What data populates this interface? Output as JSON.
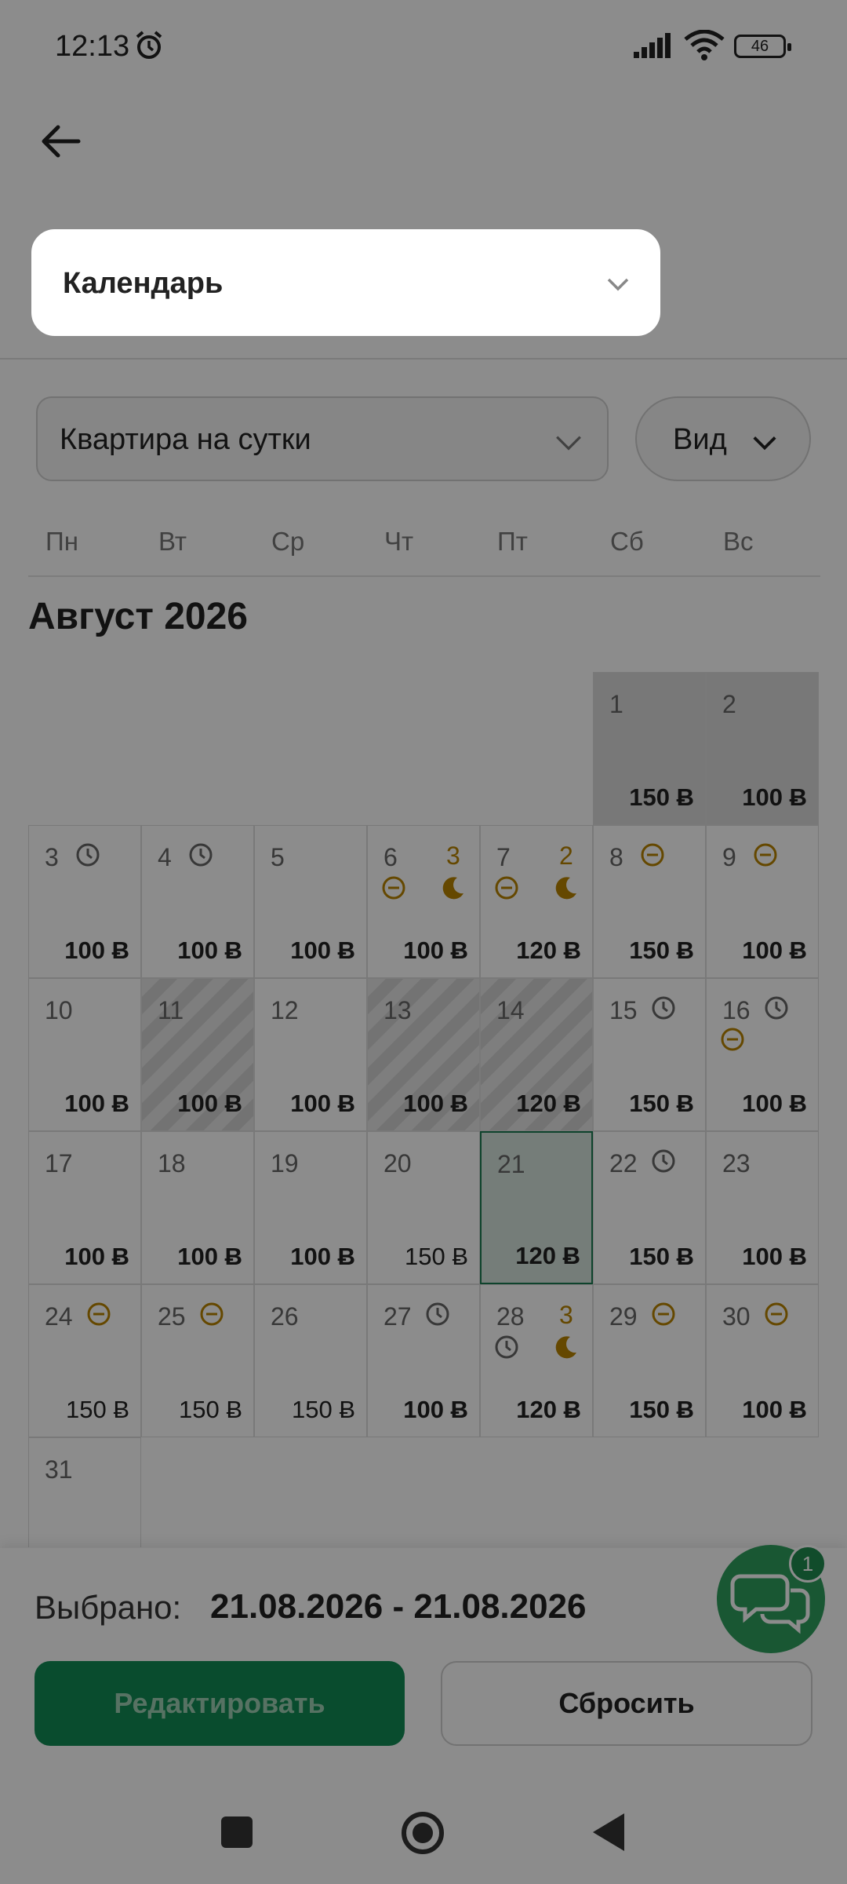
{
  "status": {
    "time": "12:13",
    "battery": "46"
  },
  "page_select": {
    "label": "Календарь"
  },
  "property_select": {
    "label": "Квартира на сутки"
  },
  "view_button": {
    "label": "Вид"
  },
  "weekdays": [
    "Пн",
    "Вт",
    "Ср",
    "Чт",
    "Пт",
    "Сб",
    "Вс"
  ],
  "month_title": "Август 2026",
  "days": [
    {
      "day": "1",
      "price": "150 Ƀ",
      "bold": true,
      "style": "weekend",
      "icons": []
    },
    {
      "day": "2",
      "price": "100 Ƀ",
      "bold": true,
      "style": "weekend",
      "icons": []
    },
    {
      "day": "3",
      "price": "100 Ƀ",
      "bold": true,
      "style": "",
      "icons": [
        "clock"
      ]
    },
    {
      "day": "4",
      "price": "100 Ƀ",
      "bold": true,
      "style": "",
      "icons": [
        "clock"
      ]
    },
    {
      "day": "5",
      "price": "100 Ƀ",
      "bold": true,
      "style": "",
      "icons": []
    },
    {
      "day": "6",
      "price": "100 Ƀ",
      "bold": true,
      "style": "",
      "icons": [
        "minus-row2"
      ],
      "count": "3"
    },
    {
      "day": "7",
      "price": "120 Ƀ",
      "bold": true,
      "style": "",
      "icons": [
        "minus-row2"
      ],
      "count": "2"
    },
    {
      "day": "8",
      "price": "150 Ƀ",
      "bold": true,
      "style": "",
      "icons": [
        "minus"
      ]
    },
    {
      "day": "9",
      "price": "100 Ƀ",
      "bold": true,
      "style": "",
      "icons": [
        "minus"
      ]
    },
    {
      "day": "10",
      "price": "100 Ƀ",
      "bold": true,
      "style": "",
      "icons": []
    },
    {
      "day": "11",
      "price": "100 Ƀ",
      "bold": true,
      "style": "striped",
      "icons": []
    },
    {
      "day": "12",
      "price": "100 Ƀ",
      "bold": true,
      "style": "",
      "icons": []
    },
    {
      "day": "13",
      "price": "100 Ƀ",
      "bold": true,
      "style": "striped",
      "icons": []
    },
    {
      "day": "14",
      "price": "120 Ƀ",
      "bold": true,
      "style": "striped",
      "icons": []
    },
    {
      "day": "15",
      "price": "150 Ƀ",
      "bold": true,
      "style": "",
      "icons": [
        "clock"
      ]
    },
    {
      "day": "16",
      "price": "100 Ƀ",
      "bold": true,
      "style": "",
      "icons": [
        "clock",
        "minus-row2-left"
      ]
    },
    {
      "day": "17",
      "price": "100 Ƀ",
      "bold": true,
      "style": "",
      "icons": []
    },
    {
      "day": "18",
      "price": "100 Ƀ",
      "bold": true,
      "style": "",
      "icons": []
    },
    {
      "day": "19",
      "price": "100 Ƀ",
      "bold": true,
      "style": "",
      "icons": []
    },
    {
      "day": "20",
      "price": "150 Ƀ",
      "bold": false,
      "style": "",
      "icons": []
    },
    {
      "day": "21",
      "price": "120 Ƀ",
      "bold": true,
      "style": "selected",
      "icons": []
    },
    {
      "day": "22",
      "price": "150 Ƀ",
      "bold": true,
      "style": "",
      "icons": [
        "clock"
      ]
    },
    {
      "day": "23",
      "price": "100 Ƀ",
      "bold": true,
      "style": "",
      "icons": []
    },
    {
      "day": "24",
      "price": "150 Ƀ",
      "bold": false,
      "style": "",
      "icons": [
        "minus"
      ]
    },
    {
      "day": "25",
      "price": "150 Ƀ",
      "bold": false,
      "style": "",
      "icons": [
        "minus"
      ]
    },
    {
      "day": "26",
      "price": "150 Ƀ",
      "bold": false,
      "style": "",
      "icons": []
    },
    {
      "day": "27",
      "price": "100 Ƀ",
      "bold": true,
      "style": "",
      "icons": [
        "clock"
      ]
    },
    {
      "day": "28",
      "price": "120 Ƀ",
      "bold": true,
      "style": "",
      "icons": [
        "clock-row2"
      ],
      "count": "3"
    },
    {
      "day": "29",
      "price": "150 Ƀ",
      "bold": true,
      "style": "",
      "icons": [
        "minus"
      ]
    },
    {
      "day": "30",
      "price": "100 Ƀ",
      "bold": true,
      "style": "",
      "icons": [
        "minus"
      ]
    },
    {
      "day": "31",
      "price": "",
      "bold": false,
      "style": "",
      "icons": []
    }
  ],
  "bottom": {
    "selected_label": "Выбрано:",
    "selected_value": "21.08.2026 - 21.08.2026",
    "edit_label": "Редактировать",
    "reset_label": "Сбросить"
  },
  "chat": {
    "badge": "1"
  },
  "colors": {
    "accent": "#128a55",
    "warning": "#b98400",
    "selected_bg": "#d5e3dc"
  }
}
